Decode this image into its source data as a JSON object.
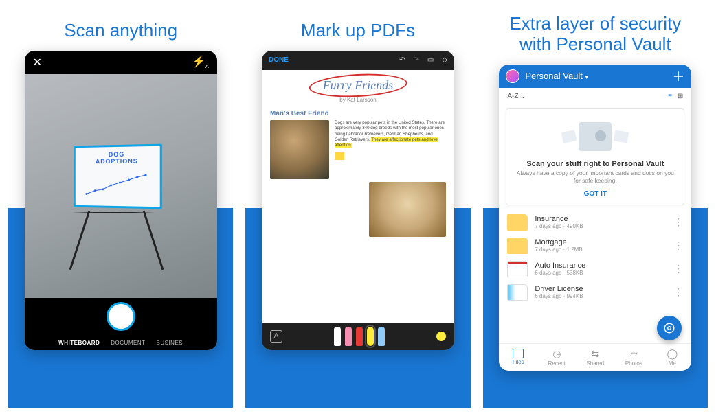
{
  "panels": {
    "scan": {
      "title": "Scan anything",
      "board_line1": "DOG",
      "board_line2": "ADOPTIONS",
      "tabs": {
        "whiteboard": "WHITEBOARD",
        "document": "DOCUMENT",
        "business": "BUSINES"
      }
    },
    "pdf": {
      "title": "Mark up PDFs",
      "done": "DONE",
      "doc_title": "Furry Friends",
      "byline": "by Kat Larsson",
      "section": "Man's Best Friend",
      "body": "Dogs are very popular pets in the United States. There are approximately 340 dog breeds with the most popular ones being Labrador Retrievers, German Shepherds, and Golden Retrievers. ",
      "body_hl": "They are affectionate pets and love attention.",
      "pen_tool": "A"
    },
    "vault": {
      "title_line1": "Extra layer of security",
      "title_line2": "with Personal Vault",
      "header": "Personal Vault",
      "sort": "A-Z",
      "card": {
        "title": "Scan your stuff right to Personal Vault",
        "subtitle": "Always have a copy of your important cards and docs on you for safe keeping.",
        "action": "GOT IT"
      },
      "files": [
        {
          "name": "Insurance",
          "meta": "7 days ago · 490KB",
          "thumb": "folder"
        },
        {
          "name": "Mortgage",
          "meta": "7 days ago · 1.2MB",
          "thumb": "folder"
        },
        {
          "name": "Auto Insurance",
          "meta": "6 days ago · 538KB",
          "thumb": "doc"
        },
        {
          "name": "Driver License",
          "meta": "6 days ago · 994KB",
          "thumb": "card"
        }
      ],
      "tabs": {
        "files": "Files",
        "recent": "Recent",
        "shared": "Shared",
        "photos": "Photos",
        "me": "Me"
      }
    }
  }
}
